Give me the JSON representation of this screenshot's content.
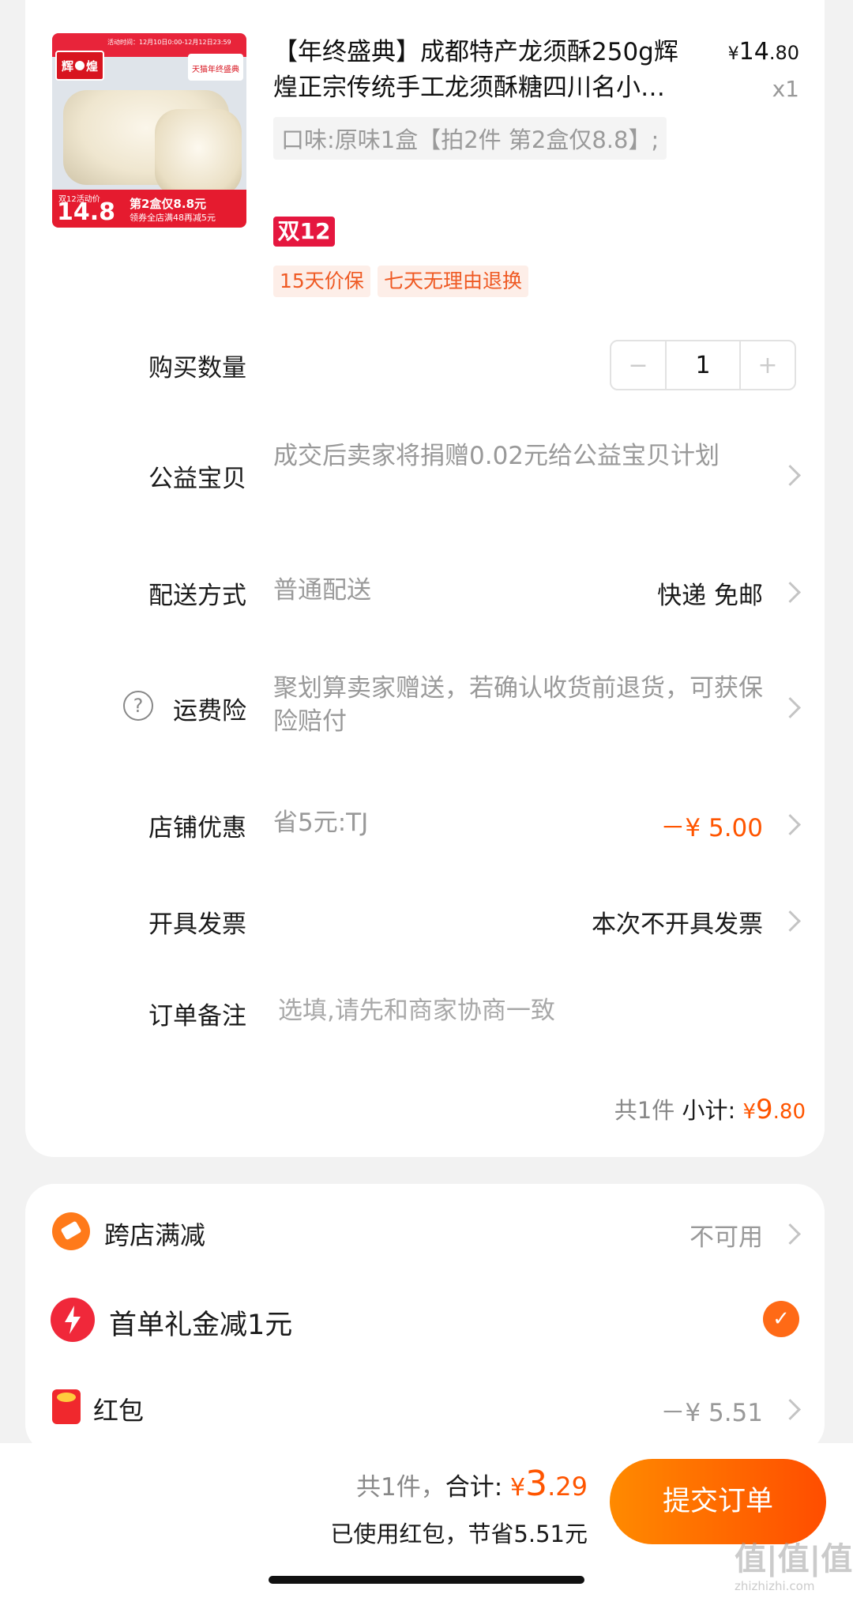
{
  "product": {
    "title": "【年终盛典】成都特产龙须酥250g辉煌正宗传统手工龙须酥糖四川名小…",
    "price_symbol": "¥",
    "price_int": "14",
    "price_dec": ".80",
    "quantity_text": "x1",
    "variant": "口味:原味1盒【拍2件 第2盒仅8.8】;",
    "badge": "双12",
    "tags": [
      "15天价保",
      "七天无理由退换"
    ],
    "image": {
      "brand": "辉",
      "brand2": "煌",
      "tmall_label": "天猫年终盛典",
      "date_strip": "活动时间：12月10日0:00-12月12日23:59",
      "price_caption": "双12活动价",
      "price": "14.8",
      "promo_line1": "第2盒仅8.8元",
      "promo_line2": "领券全店满48再减5元"
    }
  },
  "quantity": {
    "label": "购买数量",
    "value": "1",
    "minus": "−",
    "plus": "+"
  },
  "charity": {
    "label": "公益宝贝",
    "text": "成交后卖家将捐赠0.02元给公益宝贝计划"
  },
  "delivery": {
    "label": "配送方式",
    "text": "普通配送",
    "value": "快递 免邮"
  },
  "shipping_insurance": {
    "label": "运费险",
    "text": "聚划算卖家赠送，若确认收货前退货，可获保险赔付",
    "help_icon": "?"
  },
  "shop_discount": {
    "label": "店铺优惠",
    "text": "省5元:TJ",
    "value": "－¥ 5.00"
  },
  "invoice": {
    "label": "开具发票",
    "value": "本次不开具发票"
  },
  "note": {
    "label": "订单备注",
    "placeholder": "选填,请先和商家协商一致"
  },
  "subtotal": {
    "count": "共1件",
    "label": "小计:",
    "symbol": "¥",
    "int": "9",
    "dec": ".80"
  },
  "options": {
    "cross_store": {
      "label": "跨店满减",
      "value": "不可用"
    },
    "first_order": {
      "label": "首单礼金减1元",
      "checked": true
    },
    "red_packet": {
      "label": "红包",
      "value": "－¥ 5.51"
    }
  },
  "footer": {
    "count": "共1件，",
    "total_label": "合计:",
    "symbol": "¥",
    "int": "3",
    "dec": ".29",
    "saving": "已使用红包，节省5.51元",
    "submit": "提交订单"
  },
  "watermark": {
    "text": "值|值|值",
    "site": "zhizhizhi.com"
  },
  "colors": {
    "accent": "#ff5500",
    "button": "#ff6a00",
    "badge": "#e5173f"
  }
}
